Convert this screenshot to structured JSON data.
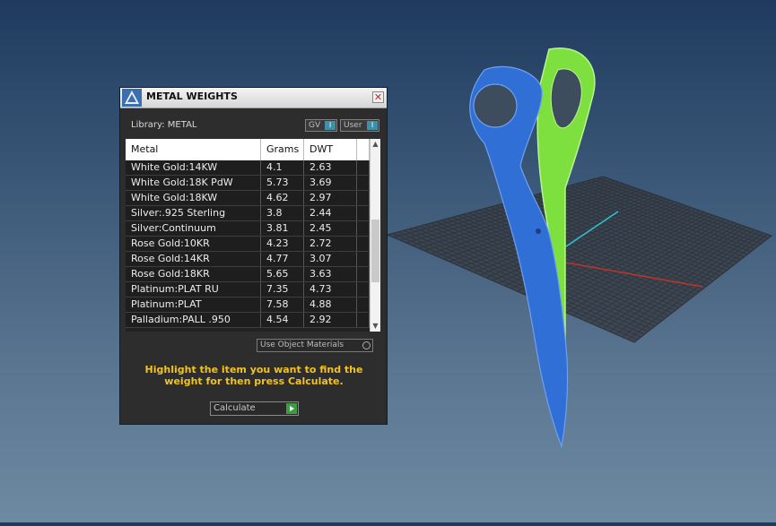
{
  "dialog": {
    "title": "METAL WEIGHTS",
    "library_label": "Library: METAL",
    "gv_label": "GV",
    "user_label": "User",
    "close_glyph": "✕",
    "columns": [
      "Metal",
      "Grams",
      "DWT"
    ],
    "rows": [
      [
        "White Gold:14KW",
        "4.1",
        "2.63"
      ],
      [
        "White Gold:18K PdW",
        "5.73",
        "3.69"
      ],
      [
        "White Gold:18KW",
        "4.62",
        "2.97"
      ],
      [
        "Silver:.925 Sterling",
        "3.8",
        "2.44"
      ],
      [
        "Silver:Continuum",
        "3.81",
        "2.45"
      ],
      [
        "Rose Gold:10KR",
        "4.23",
        "2.72"
      ],
      [
        "Rose Gold:14KR",
        "4.77",
        "3.07"
      ],
      [
        "Rose Gold:18KR",
        "5.65",
        "3.63"
      ],
      [
        "Platinum:PLAT RU",
        "7.35",
        "4.73"
      ],
      [
        "Platinum:PLAT",
        "7.58",
        "4.88"
      ],
      [
        "Palladium:PALL .950",
        "4.54",
        "2.92"
      ]
    ],
    "use_object_materials_label": "Use Object Materials",
    "instructions": "Highlight the item you want to find the weight for then press Calculate.",
    "calculate_label": "Calculate"
  },
  "icons": {
    "close": "close-icon",
    "scroll_up": "chevron-up-icon",
    "scroll_down": "chevron-down-icon",
    "calculate": "play-icon"
  },
  "colors": {
    "accent_yellow": "#f2c320",
    "model_blue": "#2f6fd6",
    "model_green": "#7ee03e",
    "toggle_teal": "#3e8fa8"
  }
}
